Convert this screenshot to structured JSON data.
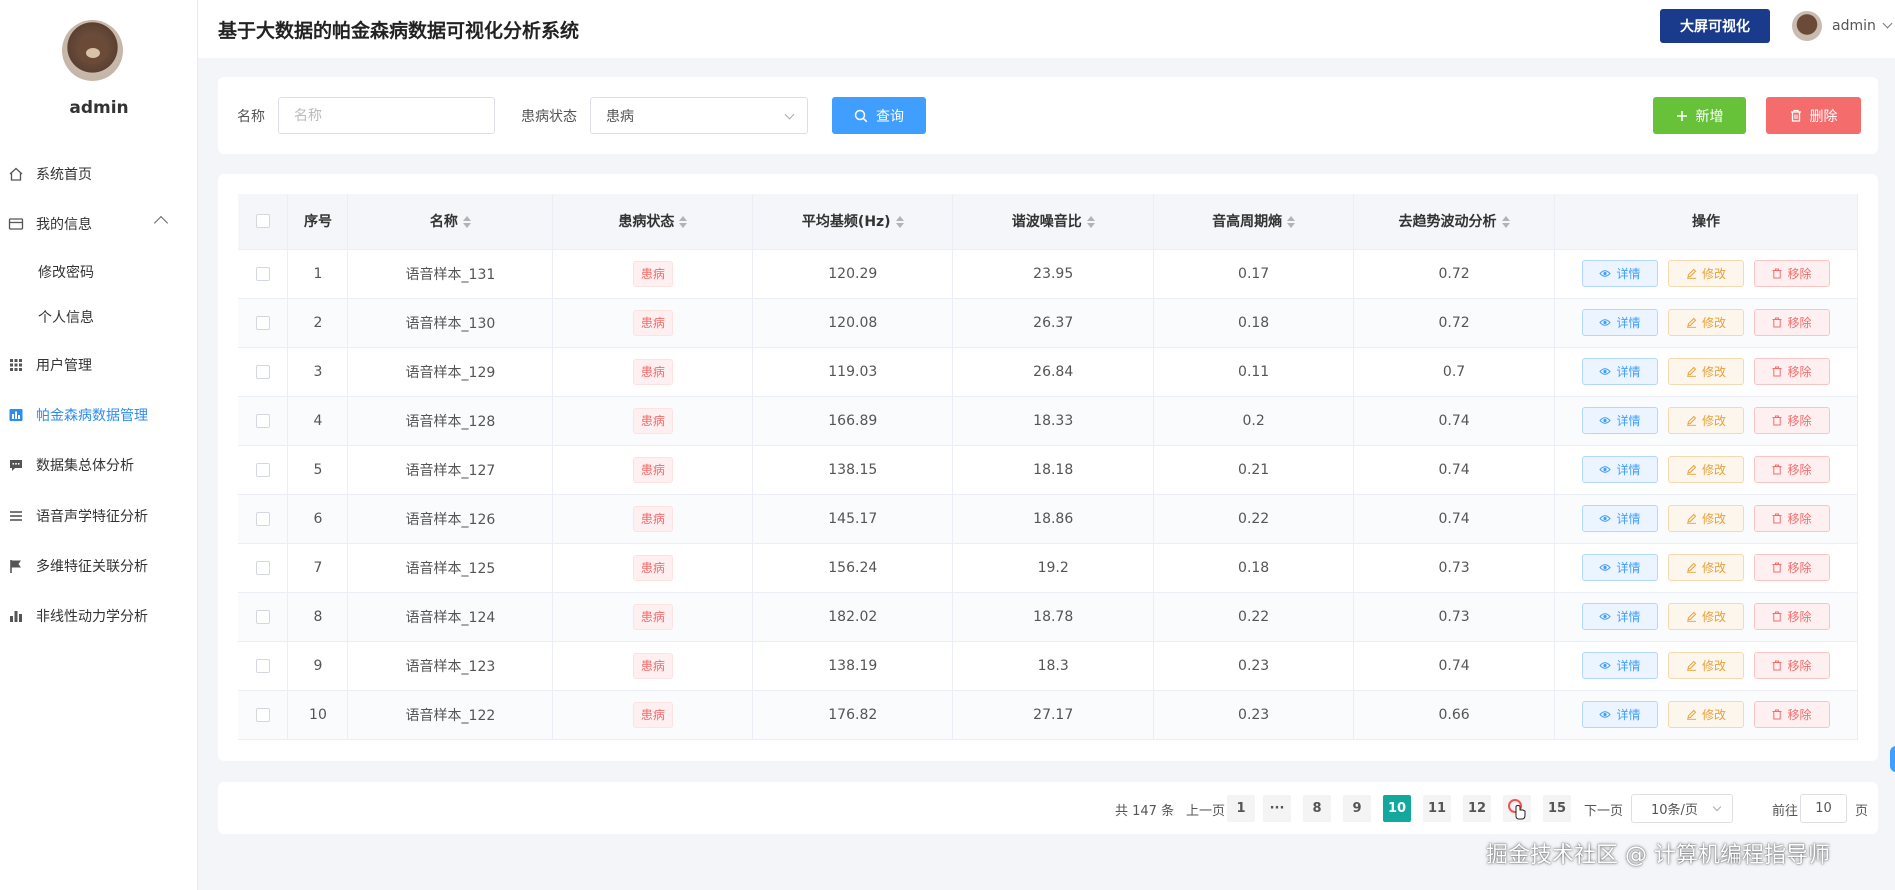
{
  "sidebar": {
    "username": "admin",
    "items": [
      {
        "label": "系统首页",
        "icon": "home-icon"
      },
      {
        "label": "我的信息",
        "icon": "card-icon"
      },
      {
        "label": "修改密码",
        "icon": ""
      },
      {
        "label": "个人信息",
        "icon": ""
      },
      {
        "label": "用户管理",
        "icon": "grid-icon"
      },
      {
        "label": "帕金森病数据管理",
        "icon": "chart-book-icon"
      },
      {
        "label": "数据集总体分析",
        "icon": "message-icon"
      },
      {
        "label": "语音声学特征分析",
        "icon": "list-icon"
      },
      {
        "label": "多维特征关联分析",
        "icon": "flag-icon"
      },
      {
        "label": "非线性动力学分析",
        "icon": "bar-chart-icon"
      }
    ]
  },
  "header": {
    "title": "基于大数据的帕金森病数据可视化分析系统",
    "big_screen_label": "大屏可视化",
    "username": "admin"
  },
  "filter": {
    "name_label": "名称",
    "name_placeholder": "名称",
    "status_label": "患病状态",
    "status_value": "患病",
    "search_label": "查询",
    "add_label": "新增",
    "delete_label": "删除"
  },
  "table": {
    "headers": {
      "index": "序号",
      "name": "名称",
      "status": "患病状态",
      "fo": "平均基频(Hz)",
      "hnr": "谐波噪音比",
      "ppe": "音高周期熵",
      "dfa": "去趋势波动分析",
      "ops": "操作"
    },
    "actions": {
      "detail": "详情",
      "edit": "修改",
      "remove": "移除"
    },
    "rows": [
      {
        "idx": "1",
        "name": "语音样本_131",
        "status": "患病",
        "fo": "120.29",
        "hnr": "23.95",
        "ppe": "0.17",
        "dfa": "0.72"
      },
      {
        "idx": "2",
        "name": "语音样本_130",
        "status": "患病",
        "fo": "120.08",
        "hnr": "26.37",
        "ppe": "0.18",
        "dfa": "0.72"
      },
      {
        "idx": "3",
        "name": "语音样本_129",
        "status": "患病",
        "fo": "119.03",
        "hnr": "26.84",
        "ppe": "0.11",
        "dfa": "0.7"
      },
      {
        "idx": "4",
        "name": "语音样本_128",
        "status": "患病",
        "fo": "166.89",
        "hnr": "18.33",
        "ppe": "0.2",
        "dfa": "0.74"
      },
      {
        "idx": "5",
        "name": "语音样本_127",
        "status": "患病",
        "fo": "138.15",
        "hnr": "18.18",
        "ppe": "0.21",
        "dfa": "0.74"
      },
      {
        "idx": "6",
        "name": "语音样本_126",
        "status": "患病",
        "fo": "145.17",
        "hnr": "18.86",
        "ppe": "0.22",
        "dfa": "0.74"
      },
      {
        "idx": "7",
        "name": "语音样本_125",
        "status": "患病",
        "fo": "156.24",
        "hnr": "19.2",
        "ppe": "0.18",
        "dfa": "0.73"
      },
      {
        "idx": "8",
        "name": "语音样本_124",
        "status": "患病",
        "fo": "182.02",
        "hnr": "18.78",
        "ppe": "0.22",
        "dfa": "0.73"
      },
      {
        "idx": "9",
        "name": "语音样本_123",
        "status": "患病",
        "fo": "138.19",
        "hnr": "18.3",
        "ppe": "0.23",
        "dfa": "0.74"
      },
      {
        "idx": "10",
        "name": "语音样本_122",
        "status": "患病",
        "fo": "176.82",
        "hnr": "27.17",
        "ppe": "0.23",
        "dfa": "0.66"
      }
    ]
  },
  "pagination": {
    "total_text": "共 147 条",
    "prev_label": "上一页",
    "next_label": "下一页",
    "pages": [
      "1",
      "···",
      "8",
      "9",
      "10",
      "11",
      "12",
      "",
      "15"
    ],
    "current_page": "10",
    "page_size": "10条/页",
    "goto_label": "前往",
    "goto_value": "10",
    "page_unit": "页"
  },
  "watermark": "掘金技术社区 @ 计算机编程指导师",
  "colors": {
    "primary": "#409eff",
    "success": "#67c23a",
    "danger": "#f56c6c",
    "warning": "#e6a23c",
    "big_screen_bg": "#1a3b8c",
    "page_active": "#13a89e"
  }
}
